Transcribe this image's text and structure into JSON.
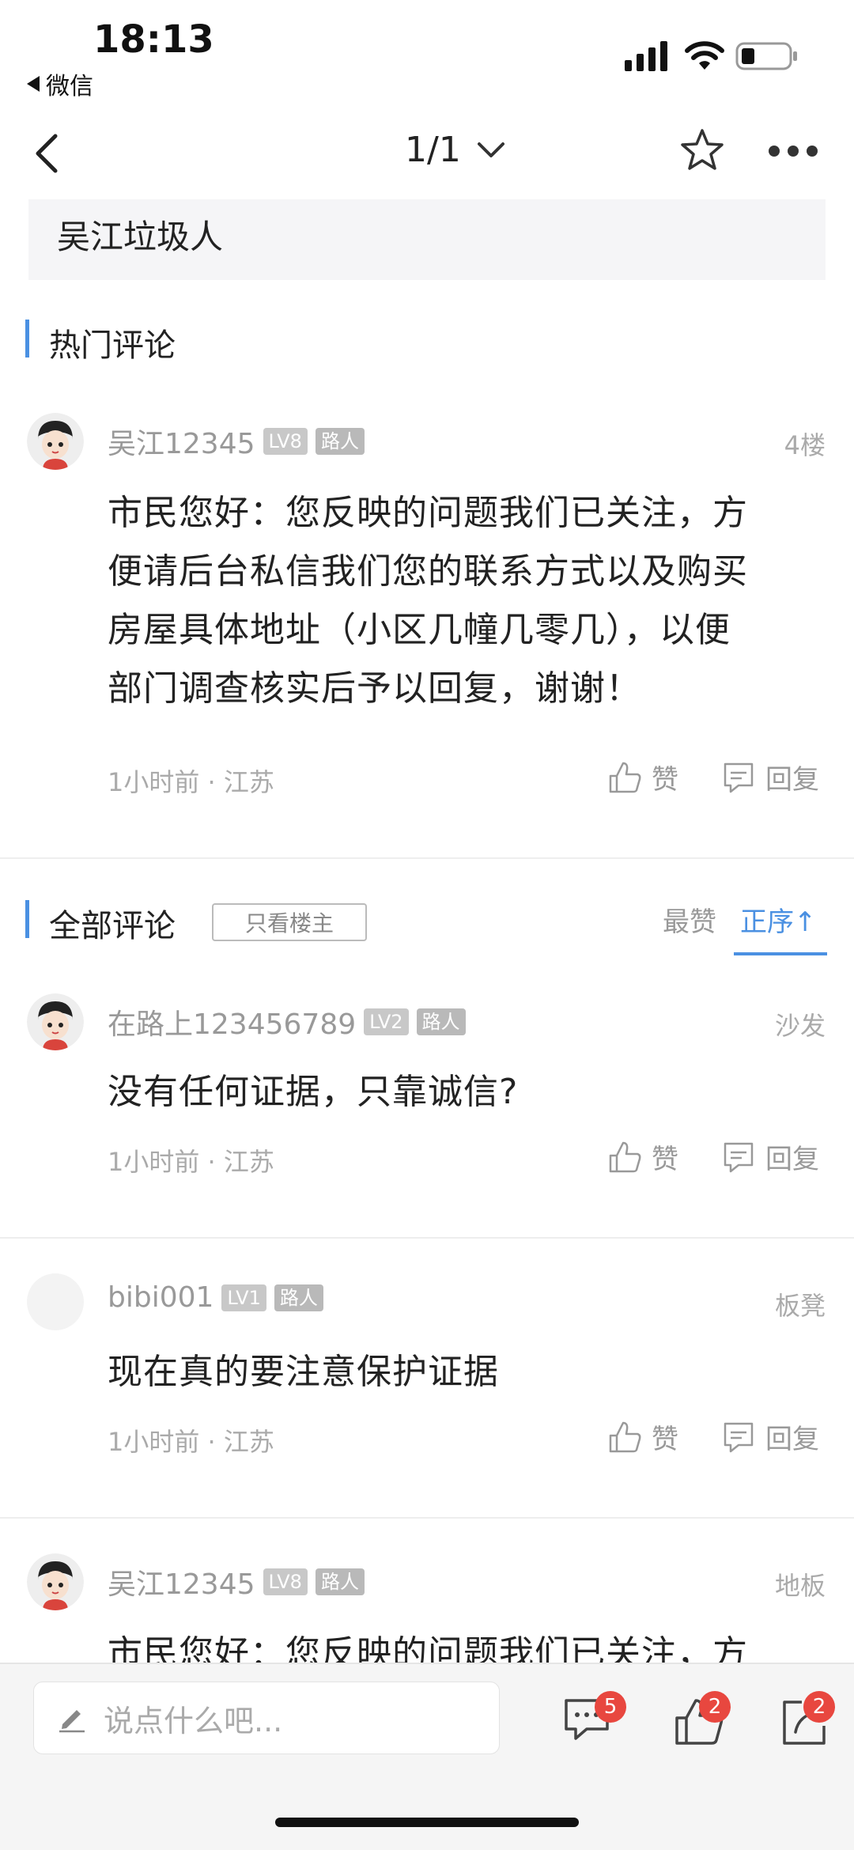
{
  "status_bar": {
    "time": "18:13",
    "back_app": "微信"
  },
  "nav": {
    "pager": "1/1"
  },
  "post_tail_text": "吴江垃圾人",
  "hot_section": {
    "title": "热门评论",
    "comments": [
      {
        "username": "吴江12345",
        "level": "LV8",
        "role": "路人",
        "floor": "4楼",
        "lines": [
          "市民您好：您反映的问题我们已关注，方",
          "便请后台私信我们您的联系方式以及购买",
          "房屋具体地址（小区几幢几零几），以便",
          "部门调查核实后予以回复，谢谢！"
        ],
        "meta": "1小时前 · 江苏",
        "like_label": "赞",
        "reply_label": "回复"
      }
    ]
  },
  "all_section": {
    "title": "全部评论",
    "filter_label": "只看楼主",
    "sort_top": "最赞",
    "sort_asc": "正序↑",
    "comments": [
      {
        "username": "在路上123456789",
        "level": "LV2",
        "role": "路人",
        "floor": "沙发",
        "lines": [
          "没有任何证据，只靠诚信?"
        ],
        "meta": "1小时前 · 江苏",
        "like_label": "赞",
        "reply_label": "回复"
      },
      {
        "username": "bibi001",
        "level": "LV1",
        "role": "路人",
        "floor": "板凳",
        "lines": [
          "现在真的要注意保护证据"
        ],
        "meta": "1小时前 · 江苏",
        "like_label": "赞",
        "reply_label": "回复"
      },
      {
        "username": "吴江12345",
        "level": "LV8",
        "role": "路人",
        "floor": "地板",
        "lines": [
          "市民您好：您反映的问题我们已关注，方"
        ],
        "meta": "",
        "like_label": "",
        "reply_label": ""
      }
    ]
  },
  "bottom_bar": {
    "input_placeholder": "说点什么吧...",
    "comment_count": "5",
    "like_count": "2",
    "share_count": "2"
  },
  "colors": {
    "accent": "#4a90e2",
    "badge_red": "#e8473f"
  }
}
